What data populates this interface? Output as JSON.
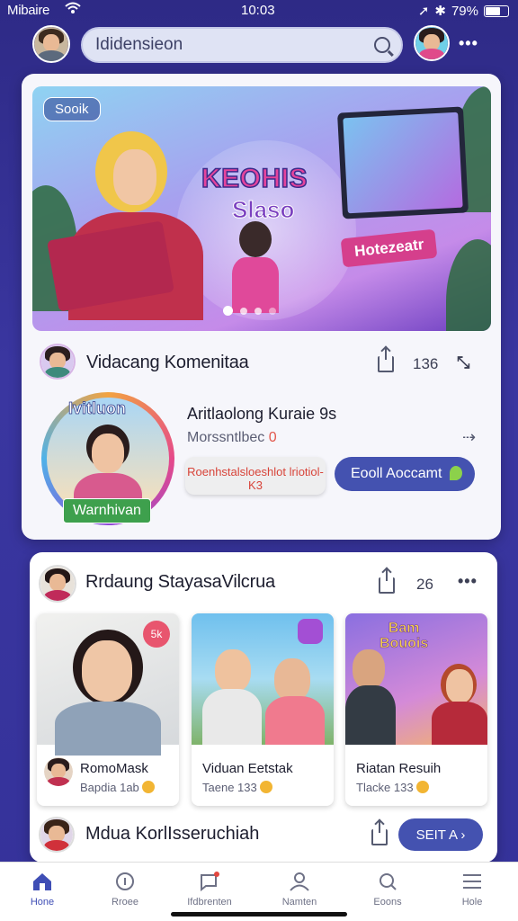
{
  "status_bar": {
    "carrier": "Mibaire",
    "time": "10:03",
    "battery": "79%"
  },
  "header": {
    "search_placeholder": "Ididensieon",
    "more_label": "•••"
  },
  "banner": {
    "tag": "Sooik",
    "title_line1": "KEOHIS",
    "title_line2": "Slaso",
    "ribbon": "Hotezeatr",
    "slide_count": 4,
    "active_slide": 0
  },
  "featured": {
    "author": "Vidacang Komenitaa",
    "share_count": "136",
    "more_label": "⤡",
    "badge_top": "Ivitluon",
    "badge_ribbon": "Warnhivan",
    "title": "Aritlaolong Kuraie 9s",
    "subtitle": "Morssntlbec",
    "subtitle_value": "0",
    "secondary_button": "Roenhstalsloeshlot lriotiol-K3",
    "primary_button": "Eooll Aoccamt"
  },
  "section": {
    "author": "Rrdaung StayasaVilcrua",
    "share_count": "26",
    "more_label": "•••",
    "tiles": [
      {
        "title": "RomoMask",
        "subtitle": "Bapdia 1ab"
      },
      {
        "title": "Viduan Eetstak",
        "subtitle": "Taene 133"
      },
      {
        "title": "Riatan Resuih",
        "subtitle": "Tlacke 133"
      }
    ],
    "tile_tag_1": "5k",
    "tile_tag_3_line1": "Bam",
    "tile_tag_3_line2": "Bouois",
    "footer_author": "Mdua KorlIsseruchiah",
    "see_button": "SEIT A  ›"
  },
  "bottom_nav": [
    {
      "label": "Hone",
      "icon": "home-icon"
    },
    {
      "label": "Rroee",
      "icon": "info-icon"
    },
    {
      "label": "Ifdbrenten",
      "icon": "notification-icon"
    },
    {
      "label": "Namten",
      "icon": "profile-icon"
    },
    {
      "label": "Eoons",
      "icon": "search-icon"
    },
    {
      "label": "Hole",
      "icon": "menu-icon"
    }
  ],
  "colors": {
    "primary": "#4452b0",
    "background": "#2e2a86",
    "accent_red": "#d8443a"
  }
}
